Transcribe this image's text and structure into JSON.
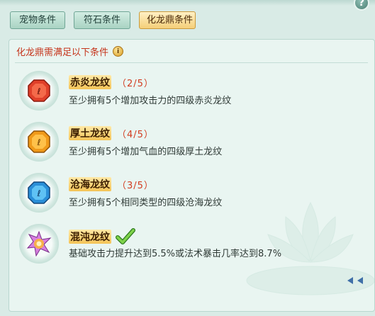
{
  "tabs": [
    {
      "label": "宠物条件",
      "active": false
    },
    {
      "label": "符石条件",
      "active": false
    },
    {
      "label": "化龙鼎条件",
      "active": true
    }
  ],
  "help": {
    "label": "?"
  },
  "panel": {
    "header": "化龙鼎需满足以下条件",
    "info_icon_glyph": "i"
  },
  "conditions": [
    {
      "title": "赤炎龙纹",
      "progress": "（2/5）",
      "desc": "至少拥有5个增加攻击力的四级赤炎龙纹",
      "gem": "red-gem-icon",
      "color": "#e0402a"
    },
    {
      "title": "厚土龙纹",
      "progress": "（4/5）",
      "desc": "至少拥有5个增加气血的四级厚土龙纹",
      "gem": "orange-gem-icon",
      "color": "#f09a1a"
    },
    {
      "title": "沧海龙纹",
      "progress": "（3/5）",
      "desc": "至少拥有5个相同类型的四级沧海龙纹",
      "gem": "blue-gem-icon",
      "color": "#2a8fd8"
    },
    {
      "title": "混沌龙纹",
      "progress": "",
      "desc": "基础攻击力提升达到5.5%或法术暴击几率达到8.7%",
      "gem": "chaos-gem-icon",
      "completed": true
    }
  ]
}
